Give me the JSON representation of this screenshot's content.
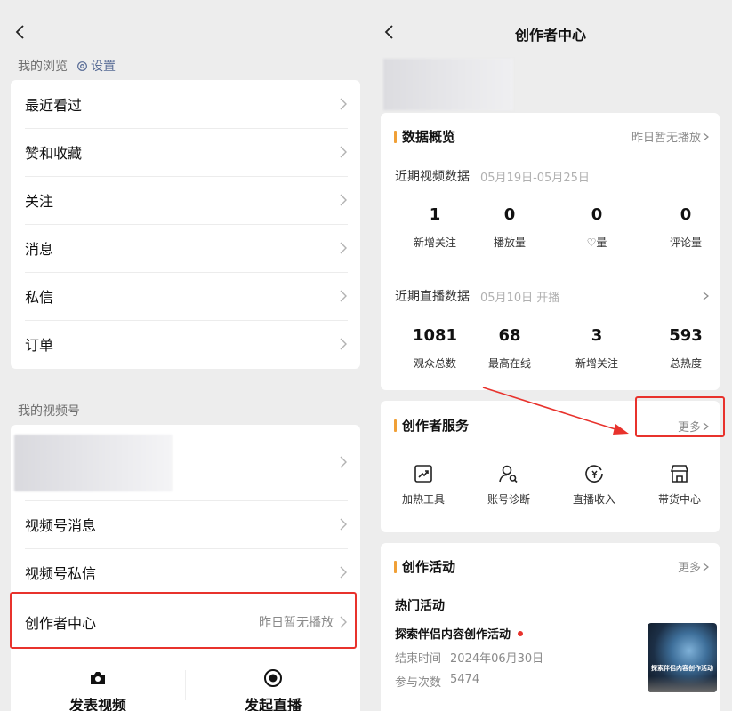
{
  "left": {
    "section_browse": "我的浏览",
    "settings_label": "设置",
    "browse_items": [
      {
        "label": "最近看过"
      },
      {
        "label": "赞和收藏"
      },
      {
        "label": "关注"
      },
      {
        "label": "消息"
      },
      {
        "label": "私信"
      },
      {
        "label": "订单"
      }
    ],
    "section_channels": "我的视频号",
    "channel_items": [
      {
        "label": "视频号消息"
      },
      {
        "label": "视频号私信"
      }
    ],
    "creator_center": {
      "label": "创作者中心",
      "status": "昨日暂无播放"
    },
    "bottom_actions": [
      {
        "label": "发表视频",
        "icon": "camera-icon"
      },
      {
        "label": "发起直播",
        "icon": "live-icon"
      }
    ]
  },
  "right": {
    "title": "创作者中心",
    "overview": {
      "title": "数据概览",
      "right_text": "昨日暂无播放",
      "video_label": "近期视频数据",
      "video_range": "05月19日-05月25日",
      "video_stats": [
        {
          "value": "1",
          "label": "新增关注"
        },
        {
          "value": "0",
          "label": "播放量"
        },
        {
          "value": "0",
          "label": "♡量"
        },
        {
          "value": "0",
          "label": "评论量"
        }
      ],
      "live_label": "近期直播数据",
      "live_info": "05月10日 开播",
      "live_stats": [
        {
          "value": "1081",
          "label": "观众总数"
        },
        {
          "value": "68",
          "label": "最高在线"
        },
        {
          "value": "3",
          "label": "新增关注"
        },
        {
          "value": "593",
          "label": "总热度"
        }
      ]
    },
    "services": {
      "title": "创作者服务",
      "more": "更多",
      "items": [
        {
          "label": "加热工具",
          "icon": "trend-chart-icon"
        },
        {
          "label": "账号诊断",
          "icon": "account-diagnosis-icon"
        },
        {
          "label": "直播收入",
          "icon": "live-income-icon"
        },
        {
          "label": "带货中心",
          "icon": "store-icon"
        }
      ]
    },
    "activities": {
      "title": "创作活动",
      "more": "更多",
      "hot_label": "热门活动",
      "activity_name": "探索伴侣内容创作活动",
      "end_label": "结束时间",
      "end_date": "2024年06月30日",
      "count_label": "参与次数",
      "count_value": "5474",
      "thumb_text": "探索伴侣内容创作活动"
    }
  },
  "colors": {
    "accent": "#f0a037",
    "highlight": "#e8322c",
    "dot": "#e8322c"
  }
}
